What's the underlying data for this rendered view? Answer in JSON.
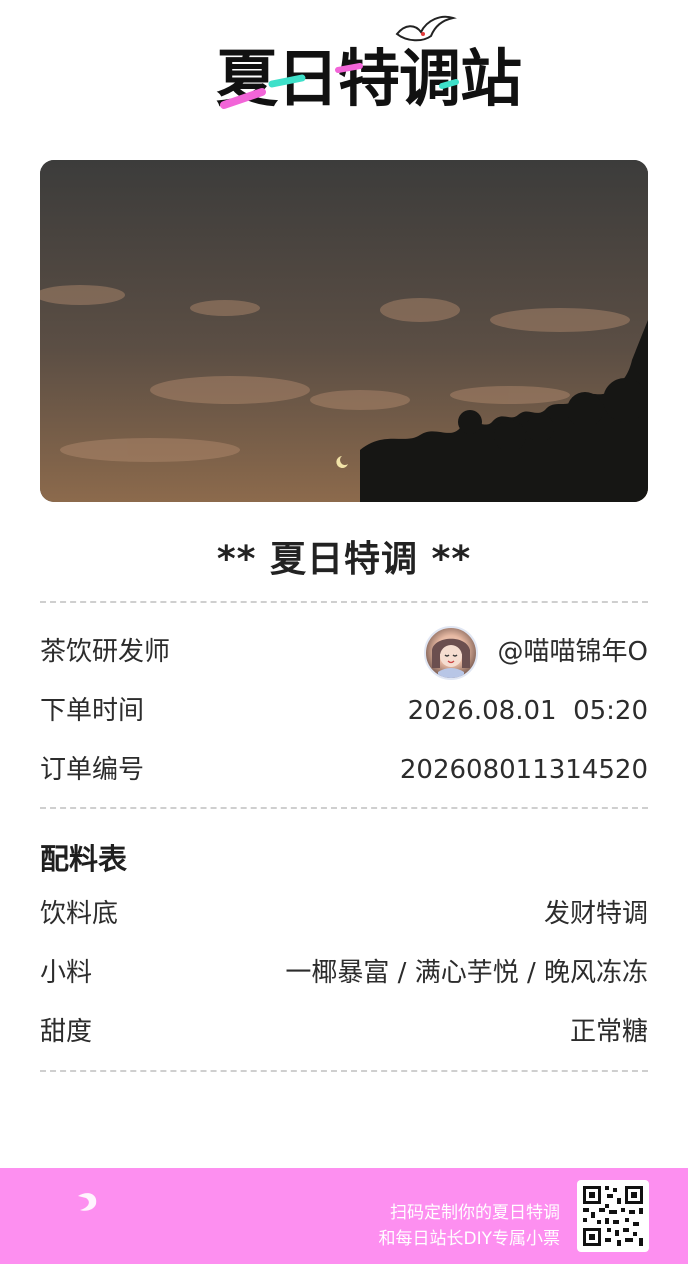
{
  "brand": {
    "logo_text": "夏日特调站",
    "colors": {
      "accent_pink": "#fd8ff0",
      "accent_teal": "#3ee0c9",
      "logo_pink": "#f265d8"
    }
  },
  "photo": {
    "description_icon": "night-sky-photo"
  },
  "receipt": {
    "title": "** 夏日特调 **",
    "rows": [
      {
        "label": "茶饮研发师",
        "value": "@喵喵锦年O"
      },
      {
        "label": "下单时间",
        "value": "2026.08.01  05:20"
      },
      {
        "label": "订单编号",
        "value": "202608011314520"
      }
    ]
  },
  "ingredients": {
    "heading": "配料表",
    "rows": [
      {
        "label": "饮料底",
        "value": "发财特调"
      },
      {
        "label": "小料",
        "value": "一椰暴富 / 满心芋悦 / 晚风冻冻"
      },
      {
        "label": "甜度",
        "value": "正常糖"
      }
    ]
  },
  "footer": {
    "line1": "扫码定制你的夏日特调",
    "line2": "和每日站长DIY专属小票"
  }
}
